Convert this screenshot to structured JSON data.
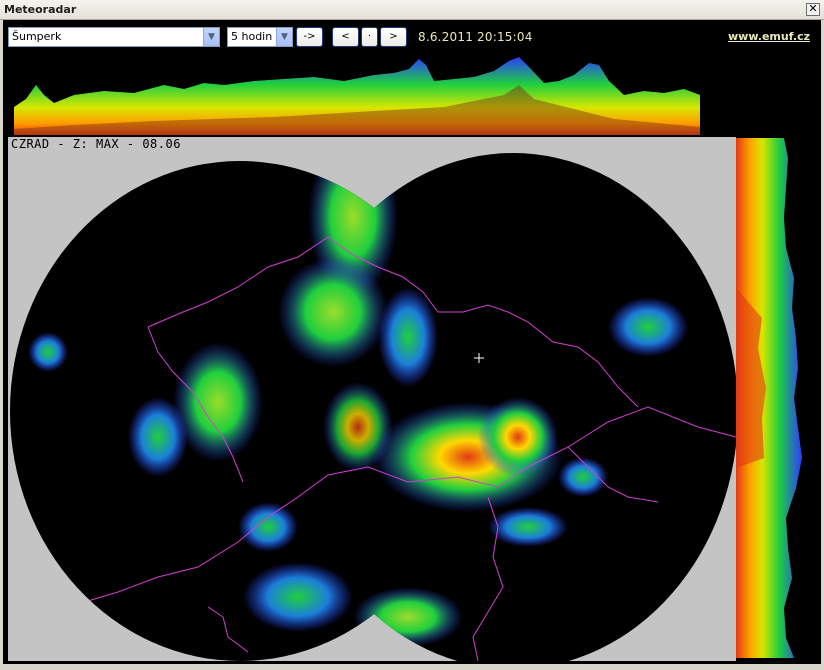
{
  "window": {
    "title": "Meteoradar",
    "close_icon": "close-icon"
  },
  "toolbar": {
    "location_select": {
      "value": "Šumperk"
    },
    "period_select": {
      "value": "5 hodin"
    },
    "go_label": "->",
    "prev_label": "<",
    "current_label": "·",
    "next_label": ">",
    "timestamp": "8.6.2011 20:15:04",
    "site_link": "www.emuf.cz"
  },
  "radar": {
    "label": "CZRAD - Z: MAX - 08.06",
    "colors": {
      "background": "#c4c4c4",
      "coverage": "#000000",
      "border": "#d23fd2",
      "rain_light": "#2a3dff",
      "rain_mid": "#1fcf3d",
      "rain_heavy": "#ffd800",
      "rain_extreme": "#e23a14"
    },
    "marker_icon": "crosshair-icon"
  }
}
